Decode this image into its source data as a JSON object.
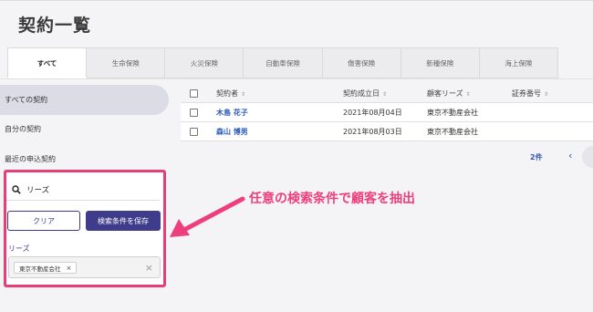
{
  "page": {
    "title": "契約一覧"
  },
  "tabs": [
    {
      "label": "すべて"
    },
    {
      "label": "生命保険"
    },
    {
      "label": "火災保険"
    },
    {
      "label": "自動車保険"
    },
    {
      "label": "傷害保険"
    },
    {
      "label": "新種保険"
    },
    {
      "label": "海上保険"
    }
  ],
  "sidebar": {
    "items": [
      {
        "label": "すべての契約"
      },
      {
        "label": "自分の契約"
      },
      {
        "label": "最近の申込契約"
      }
    ]
  },
  "table": {
    "headers": [
      {
        "label": "契約者",
        "sort": "⇕"
      },
      {
        "label": "契約成立日",
        "sort": "⇕"
      },
      {
        "label": "顧客リーズ",
        "sort": "⇕"
      },
      {
        "label": "証券番号",
        "sort": "⇕"
      }
    ],
    "rows": [
      {
        "name": "木島 花子",
        "date": "2021年08月04日",
        "lead": "東京不動産会社",
        "policy": ""
      },
      {
        "name": "森山 博男",
        "date": "2021年08月03日",
        "lead": "東京不動産会社",
        "policy": ""
      }
    ]
  },
  "pagination": {
    "count": "2件",
    "prev": "‹"
  },
  "search": {
    "query": "リーズ",
    "clear_label": "クリア",
    "save_label": "検索条件を保存",
    "filter_label": "リーズ",
    "chip": "東京不動産会社",
    "chip_remove": "×",
    "select_clear": "×"
  },
  "annotation": {
    "text": "任意の検索条件で顧客を抽出",
    "color": "#ee3f7b"
  },
  "colors": {
    "accent": "#403c8c",
    "link": "#2a5bb8",
    "highlight": "#e83e76"
  }
}
